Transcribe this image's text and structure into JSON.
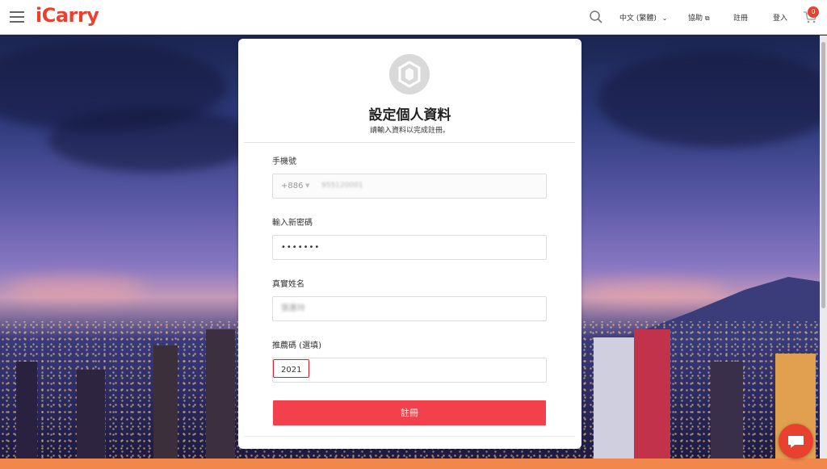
{
  "header": {
    "logo": "iCarry",
    "language": "中文 (繁體)",
    "help": "協助",
    "register": "註冊",
    "login": "登入",
    "cart_count": "0"
  },
  "form": {
    "title": "設定個人資料",
    "subtitle": "請輸入資料以完成註冊。",
    "phone": {
      "label": "手機號",
      "country_code": "+886",
      "value": "955120001"
    },
    "password": {
      "label": "輸入新密碼",
      "value": "•••••••"
    },
    "name": {
      "label": "真實姓名",
      "value": "張惠玲"
    },
    "referral": {
      "label": "推薦碼 (選填)",
      "value": "2021"
    },
    "submit_label": "註冊"
  },
  "colors": {
    "brand": "#e8412f",
    "button": "#f2414c",
    "highlight": "#e5191e"
  },
  "icons": [
    "menu-icon",
    "search-icon",
    "external-link-icon",
    "chevron-down-icon",
    "cart-icon",
    "chat-icon",
    "user-logo-icon"
  ]
}
